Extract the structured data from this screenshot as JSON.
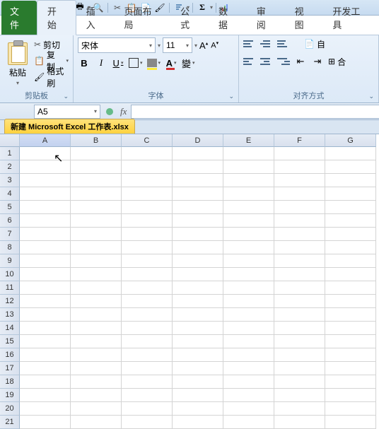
{
  "tabs": {
    "file": "文件",
    "home": "开始",
    "insert": "插入",
    "layout": "页面布局",
    "formula": "公式",
    "data": "数据",
    "review": "审阅",
    "view": "视图",
    "dev": "开发工具"
  },
  "clipboard": {
    "paste": "粘贴",
    "cut": "剪切",
    "copy": "复制",
    "format_painter": "格式刷",
    "group_label": "剪贴板"
  },
  "font": {
    "name": "宋体",
    "size": "11",
    "bold": "B",
    "italic": "I",
    "underline": "U",
    "fontcolor_letter": "A",
    "group_label": "字体"
  },
  "align": {
    "auto": "自",
    "merge": "合",
    "group_label": "对齐方式"
  },
  "namebox": "A5",
  "fx": "fx",
  "book_tab": "新建 Microsoft Excel 工作表.xlsx",
  "columns": [
    "A",
    "B",
    "C",
    "D",
    "E",
    "F",
    "G"
  ],
  "rows": [
    "1",
    "2",
    "3",
    "4",
    "5",
    "6",
    "7",
    "8",
    "9",
    "10",
    "11",
    "12",
    "13",
    "14",
    "15",
    "16",
    "17",
    "18",
    "19",
    "20",
    "21"
  ]
}
